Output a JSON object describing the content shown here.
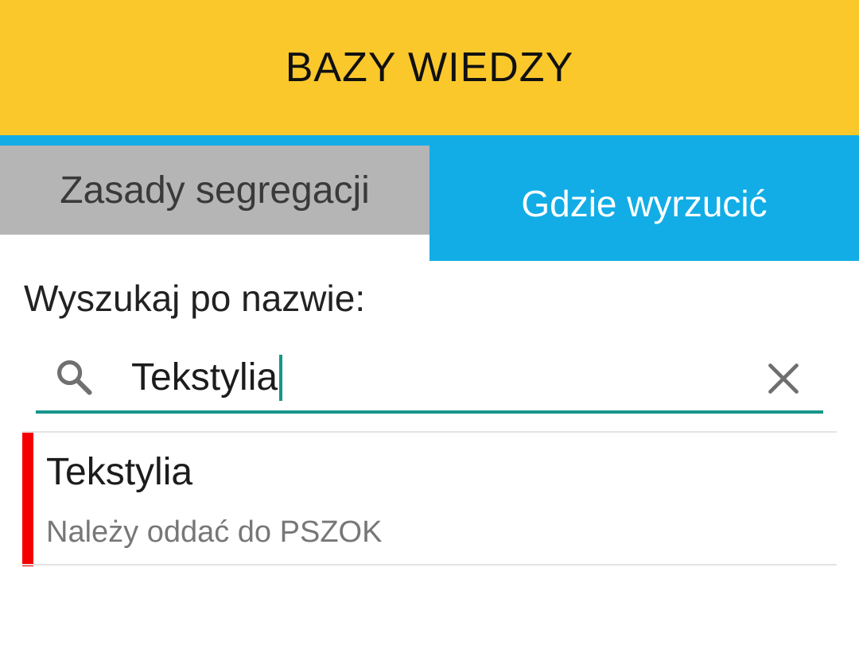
{
  "header": {
    "title": "BAZY WIEDZY",
    "color": "#FBC82B"
  },
  "tabs": [
    {
      "label": "Zasady segregacji",
      "active": false
    },
    {
      "label": "Gdzie wyrzucić",
      "active": true
    }
  ],
  "search": {
    "label": "Wyszukaj po nazwie:",
    "value": "Tekstylia",
    "icon": "search-icon",
    "clear_icon": "close-icon",
    "accent": "#16958A"
  },
  "results": [
    {
      "title": "Tekstylia",
      "subtitle": "Należy oddać do PSZOK",
      "marker_color": "#F50000"
    }
  ],
  "colors": {
    "tab_active": "#12ADE6",
    "tab_inactive": "#B5B5B5"
  }
}
